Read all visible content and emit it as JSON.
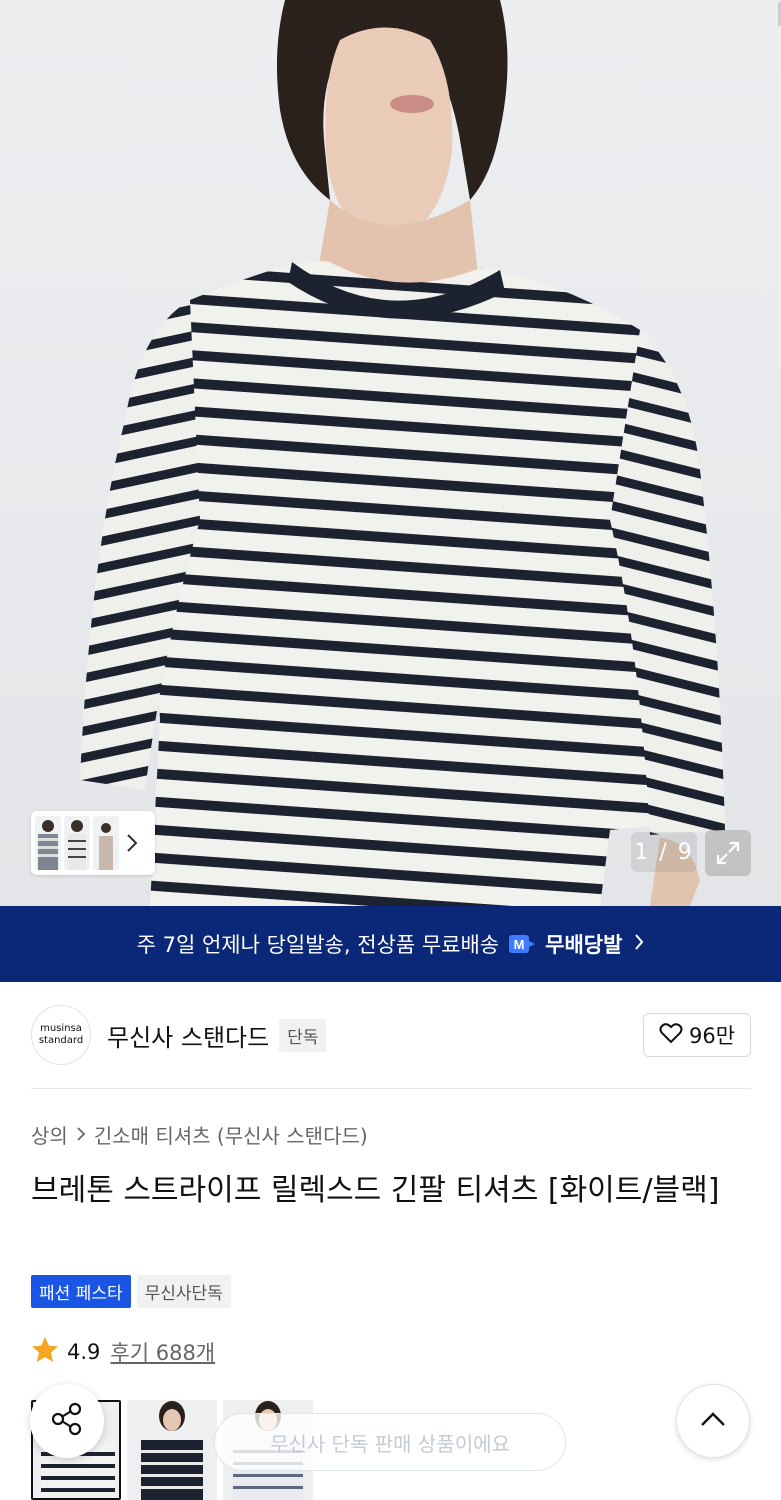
{
  "gallery": {
    "page_current": "1",
    "page_total": "9",
    "page_label": "1 / 9",
    "thumb_more_icon": "chevron-right-icon",
    "expand_icon": "expand-icon"
  },
  "promo_banner": {
    "text": "주 7일 언제나 당일발송, 전상품 무료배송",
    "service_name": "무배당발",
    "badge_letter": "M",
    "background": "#0b2777"
  },
  "brand": {
    "logo_line1": "musinsa",
    "logo_line2": "standard",
    "name": "무신사 스탠다드",
    "exclusive_label": "단독",
    "like_count": "96만",
    "like_icon": "heart-icon"
  },
  "product": {
    "breadcrumb": [
      "상의",
      "긴소매 티셔츠 (무신사 스탠다드)"
    ],
    "title": "브레톤 스트라이프 릴렉스드 긴팔 티셔츠 [화이트/블랙]",
    "tags": [
      "패션 페스타",
      "무신사단독"
    ],
    "tag_accent": "#1a55e6",
    "rating": "4.9",
    "reviews": "후기 688개",
    "star_color": "#f5a623"
  },
  "bottom": {
    "share_icon": "share-icon",
    "toast": "무신사 단독 판매 상품이에요",
    "top_icon": "chevron-up-icon"
  }
}
